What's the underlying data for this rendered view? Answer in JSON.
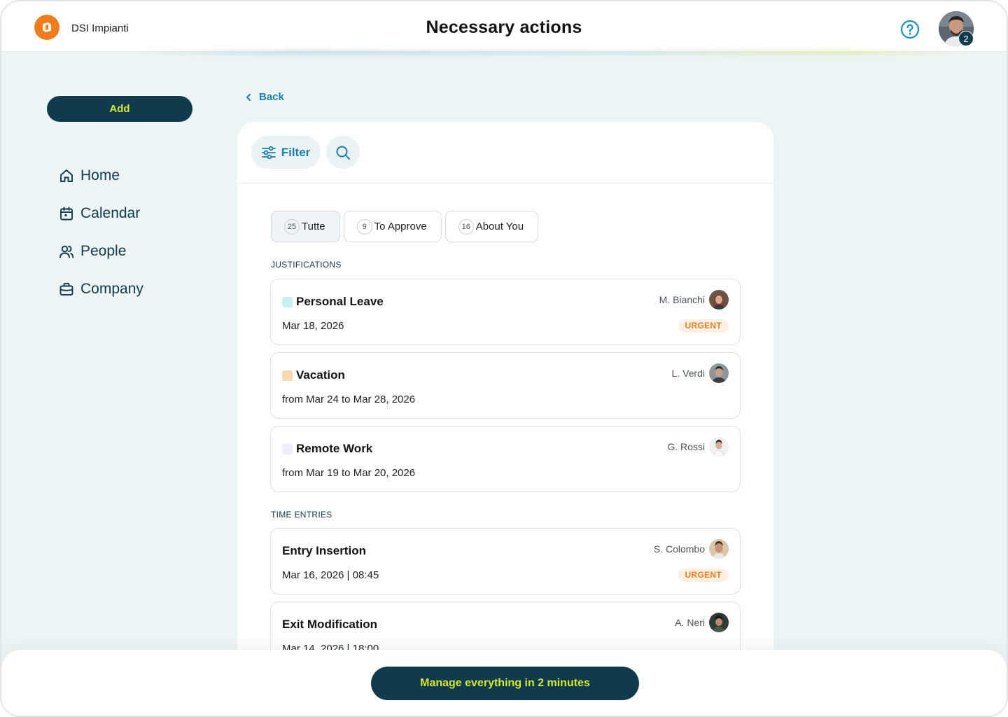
{
  "header": {
    "company_name": "DSI Impianti",
    "title": "Necessary actions",
    "help_icon": "help-circle-icon",
    "notifications_count": "2"
  },
  "sidebar": {
    "add_label": "Add",
    "items": [
      {
        "label": "Home",
        "icon": "home-icon"
      },
      {
        "label": "Calendar",
        "icon": "calendar-icon"
      },
      {
        "label": "People",
        "icon": "people-icon"
      },
      {
        "label": "Company",
        "icon": "briefcase-icon"
      }
    ]
  },
  "back_label": "Back",
  "toolbar": {
    "filter_label": "Filter",
    "search_icon": "search-icon"
  },
  "tabs": [
    {
      "count": "25",
      "label": "Tutte",
      "active": true
    },
    {
      "count": "9",
      "label": "To Approve",
      "active": false
    },
    {
      "count": "16",
      "label": "About You",
      "active": false
    }
  ],
  "sections": {
    "justifications": {
      "label": "JUSTIFICATIONS",
      "items": [
        {
          "title": "Personal Leave",
          "date": "Mar 18, 2026",
          "person": "M. Bianchi",
          "badge": "URGENT",
          "color": "#c6f2ec"
        },
        {
          "title": "Vacation",
          "date": "from Mar 24 to Mar 28, 2026",
          "person": "L. Verdi",
          "badge": "",
          "color": "#ffd8b0"
        },
        {
          "title": "Remote Work",
          "date": "from Mar 19 to Mar 20, 2026",
          "person": "G. Rossi",
          "badge": "",
          "color": "#eceff8"
        }
      ]
    },
    "time_entries": {
      "label": "TIME ENTRIES",
      "items": [
        {
          "title": "Entry Insertion",
          "date": "Mar 16, 2026 | 08:45",
          "person": "S. Colombo",
          "badge": "URGENT"
        },
        {
          "title": "Exit Modification",
          "date": "Mar 14, 2026 | 18:00",
          "person": "A. Neri",
          "badge": ""
        }
      ]
    }
  },
  "cta_label": "Manage everything in 2 minutes",
  "colors": {
    "primary": "#0f3b4d",
    "accent_lime": "#d6e833",
    "accent_blue": "#1a7fa8",
    "urgent_orange": "#f07c1b",
    "brand_orange": "#f07c1b"
  }
}
